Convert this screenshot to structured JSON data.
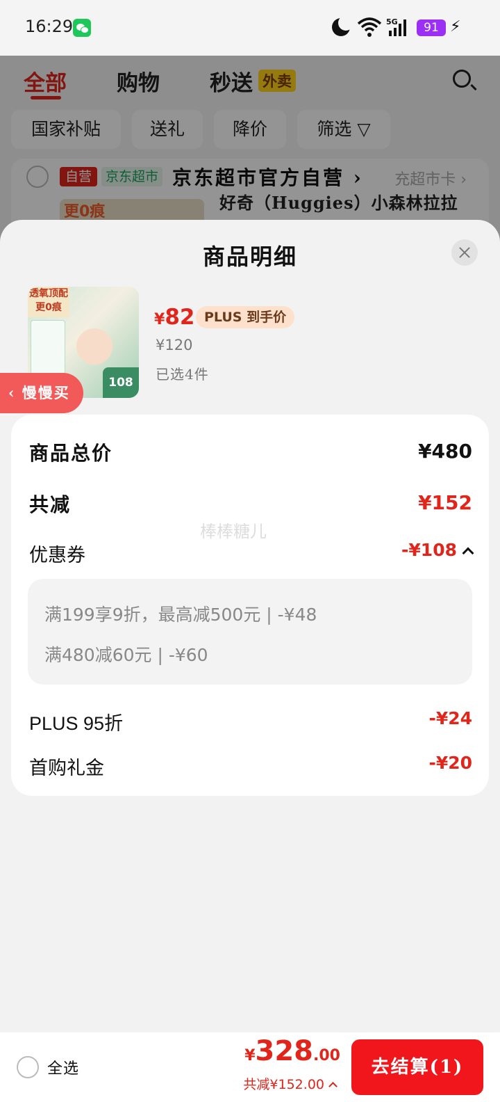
{
  "status_bar": {
    "time": "16:29",
    "battery": "91"
  },
  "background": {
    "tabs": [
      "全部",
      "购物",
      "秒送"
    ],
    "tab_badge": "外卖",
    "filters": [
      "国家补贴",
      "送礼",
      "降价",
      "筛选 ▽"
    ],
    "store": {
      "tag_self": "自营",
      "tag_market": "京东超市",
      "name": "京东超市官方自营 ›",
      "recharge": "充超市卡 ›",
      "product_title_peek": "好奇（Huggies）小森林拉拉",
      "product_image_text": "更0痕"
    }
  },
  "sheet": {
    "title": "商品明细",
    "product": {
      "image_text_top": "透氧顶配 更0痕",
      "image_badge": "108",
      "price_symbol": "¥",
      "price": "82",
      "plus_tag": "PLUS 到手价",
      "original_price": "¥120",
      "selected_count": "已选4件"
    },
    "slow_buy": "‹ 慢慢买",
    "summary": {
      "total_label": "商品总价",
      "total_value": "¥480",
      "discount_label": "共减",
      "discount_value": "¥152",
      "watermark": "棒棒糖儿",
      "coupon_label": "优惠券",
      "coupon_value": "-¥108",
      "coupon_details": [
        "满199享9折，最高减500元 | -¥48",
        "满480减60元 | -¥60"
      ],
      "plus_label": "PLUS 95折",
      "plus_value": "-¥24",
      "first_buy_label": "首购礼金",
      "first_buy_value": "-¥20"
    }
  },
  "bottom_bar": {
    "select_all": "全选",
    "price_symbol": "¥",
    "price_int": "328",
    "price_dec": ".00",
    "discount_text": "共减¥152.00",
    "checkout": "去结算(1)"
  },
  "colors": {
    "accent": "#e1251b",
    "checkout": "#f1151c",
    "battery": "#9b2ff5"
  }
}
